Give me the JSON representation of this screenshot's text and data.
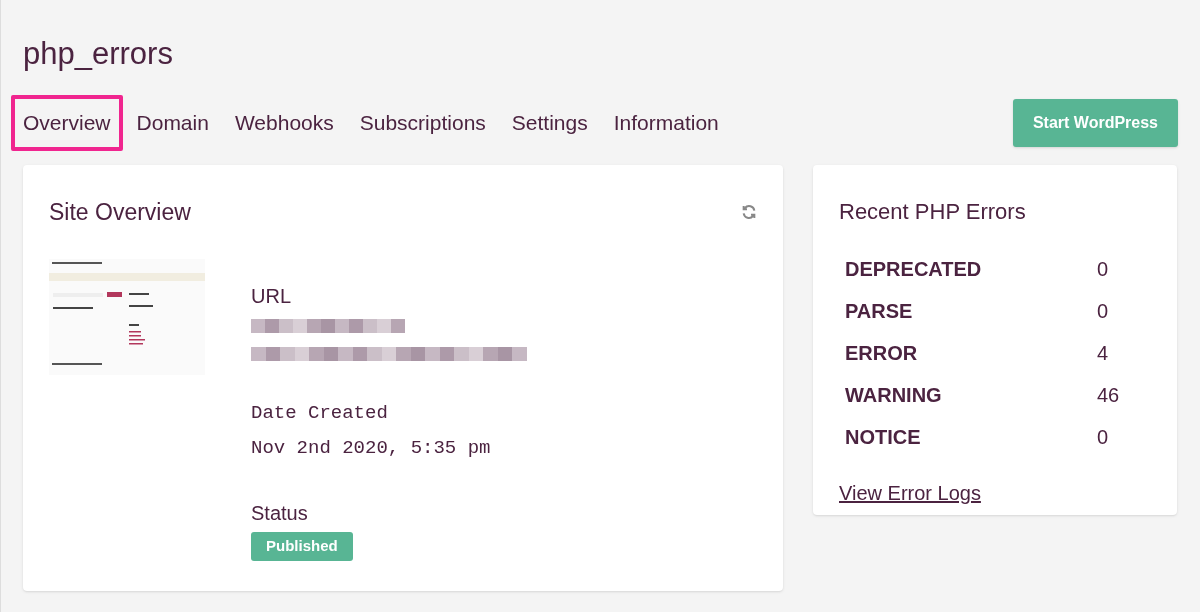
{
  "site": {
    "title": "php_errors"
  },
  "tabs": [
    {
      "label": "Overview",
      "selected": true
    },
    {
      "label": "Domain",
      "selected": false
    },
    {
      "label": "Webhooks",
      "selected": false
    },
    {
      "label": "Subscriptions",
      "selected": false
    },
    {
      "label": "Settings",
      "selected": false
    },
    {
      "label": "Information",
      "selected": false
    }
  ],
  "start_button": "Start WordPress",
  "overview": {
    "title": "Site Overview",
    "url_label": "URL",
    "date_label": "Date Created",
    "date_value": "Nov 2nd 2020, 5:35 pm",
    "status_label": "Status",
    "status": "Published"
  },
  "errors": {
    "title": "Recent PHP Errors",
    "rows": [
      {
        "type": "DEPRECATED",
        "count": "0"
      },
      {
        "type": "PARSE",
        "count": "0"
      },
      {
        "type": "ERROR",
        "count": "4"
      },
      {
        "type": "WARNING",
        "count": "46"
      },
      {
        "type": "NOTICE",
        "count": "0"
      }
    ],
    "link": "View Error Logs"
  }
}
